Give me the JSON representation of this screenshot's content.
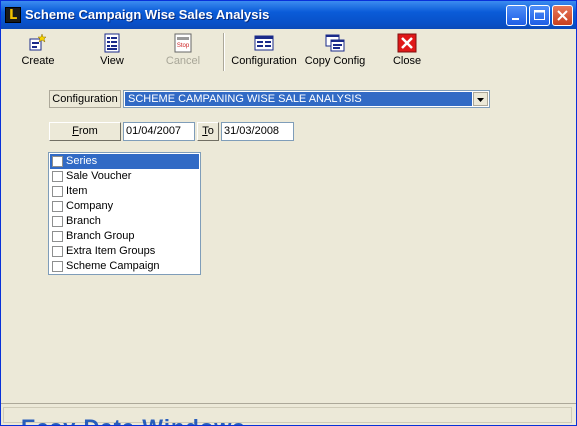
{
  "window": {
    "title": "Scheme Campaign Wise Sales Analysis",
    "app_icon_letter": "L",
    "controls": [
      "minimize-icon",
      "maximize-icon",
      "close-icon"
    ]
  },
  "toolbar": {
    "items": [
      {
        "label": "Create",
        "icon": "create-icon",
        "enabled": true
      },
      {
        "label": "View",
        "icon": "view-icon",
        "enabled": true
      },
      {
        "label": "Cancel",
        "icon": "stop-icon",
        "enabled": false
      },
      {
        "label": "Configuration",
        "icon": "configuration-icon",
        "enabled": true
      },
      {
        "label": "Copy Config",
        "icon": "copy-config-icon",
        "enabled": true
      },
      {
        "label": "Close",
        "icon": "close-icon",
        "enabled": true
      }
    ],
    "stop_icon_text": "Stop"
  },
  "configuration": {
    "label": "Configuration",
    "selected_value": "SCHEME CAMPANING WISE SALE ANALYSIS"
  },
  "date_range": {
    "from_label_access": "F",
    "from_label_rest": "rom",
    "from_value": "01/04/2007",
    "to_label_access": "T",
    "to_label_rest": "o",
    "to_value": "31/03/2008"
  },
  "group_list": {
    "items": [
      {
        "label": "Series",
        "checked": false,
        "selected": true
      },
      {
        "label": "Sale Voucher",
        "checked": false,
        "selected": false
      },
      {
        "label": "Item",
        "checked": false,
        "selected": false
      },
      {
        "label": "Company",
        "checked": false,
        "selected": false
      },
      {
        "label": "Branch",
        "checked": false,
        "selected": false
      },
      {
        "label": "Branch Group",
        "checked": false,
        "selected": false
      },
      {
        "label": "Extra Item Groups",
        "checked": false,
        "selected": false
      },
      {
        "label": "Scheme Campaign",
        "checked": false,
        "selected": false
      }
    ]
  },
  "background_text": "Easy Data Windows",
  "colors": {
    "title_bar": "#0a5bd8",
    "selection": "#316ac5",
    "window_bg": "#ece9d8",
    "background_text": "#1450b8"
  }
}
